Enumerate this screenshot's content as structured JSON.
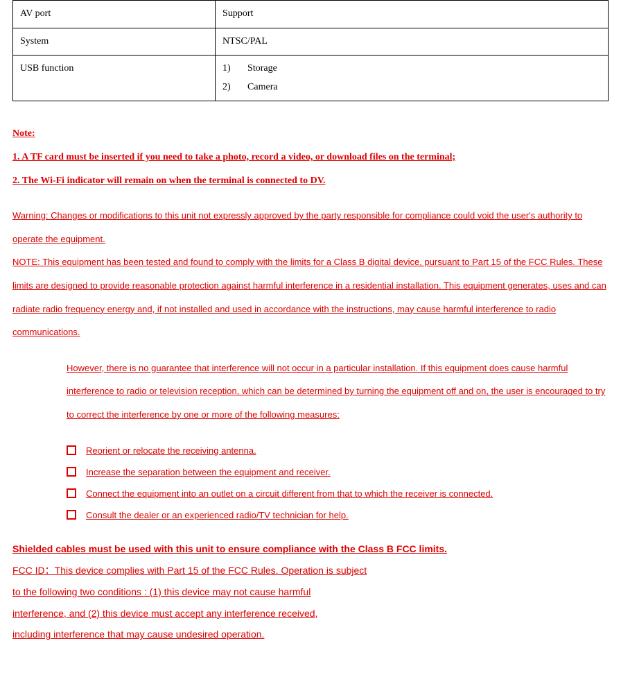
{
  "table": {
    "rows": [
      {
        "label": "AV port",
        "value": "Support"
      },
      {
        "label": "System",
        "value": "NTSC/PAL"
      }
    ],
    "usb": {
      "label": "USB function",
      "items": [
        "Storage",
        "Camera"
      ]
    }
  },
  "notes": {
    "heading": "Note:",
    "item1": "1. A TF card must be inserted if you need to take a photo, record a video, or download files on the terminal;",
    "item2": "2. The Wi-Fi indicator will remain on when the terminal is connected to DV."
  },
  "warning": {
    "p1": "Warning:  Changes or modifications to this unit not expressly approved by the party responsible for compliance could void the user's authority to operate the equipment.",
    "p2": "NOTE:  This equipment has been tested and found to comply with the limits for a Class B digital device, pursuant to Part 15 of the FCC Rules.  These limits are designed to provide reasonable protection against harmful interference in a residential installation.  This equipment generates, uses and can radiate radio frequency energy and, if not installed and used in accordance with the instructions, may cause harmful interference to radio communications.",
    "p3": "However, there is no guarantee that interference will not occur in a particular installation.  If this equipment does cause harmful interference to radio or television reception, which can be determined by turning the equipment off and on, the user is encouraged to try to correct the interference by one or more of the following measures:"
  },
  "measures": [
    "Reorient or relocate the receiving antenna.",
    "Increase the separation between the equipment and receiver.",
    "Connect the equipment into an outlet on a circuit different from that to which the  receiver is connected.",
    "Consult the dealer or an experienced radio/TV technician for help."
  ],
  "shielded": "Shielded cables must be used with this unit to ensure compliance with the Class B FCC limits.",
  "fcc": {
    "l1": "FCC ID：This device complies with Part 15 of the FCC Rules. Operation is subject",
    "l2": "to the following two conditions : (1) this device may not cause harmful",
    "l3": "interference, and (2) this device must accept any interference received,",
    "l4": "including interference that may cause undesired operation."
  }
}
